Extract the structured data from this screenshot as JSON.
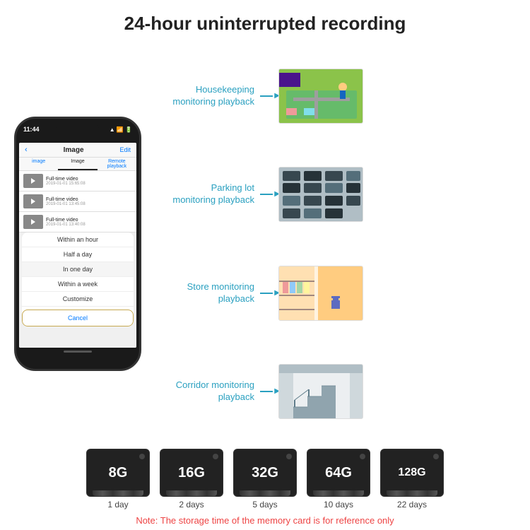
{
  "title": "24-hour uninterrupted recording",
  "phone": {
    "time": "11:44",
    "icons": "📶 🔋",
    "header": {
      "back": "‹",
      "title": "Image",
      "edit": "Edit"
    },
    "tabs": [
      "image",
      "Image",
      "Remote playback"
    ],
    "list_items": [
      {
        "label": "Full-time video",
        "time": "2019-01-01 15:65:08"
      },
      {
        "label": "Full-time video",
        "time": "2019-01-01 13:45:08"
      },
      {
        "label": "Full-time video",
        "time": "2019-01-01 13:40:08"
      }
    ],
    "dropdown": {
      "items": [
        "Within an hour",
        "Half a day",
        "In one day",
        "Within a week",
        "Customize"
      ],
      "cancel": "Cancel"
    }
  },
  "monitoring": [
    {
      "label": "Housekeeping\nmonitoring playback",
      "img_class": "img-housekeeping"
    },
    {
      "label": "Parking lot\nmonitoring playback",
      "img_class": "img-parking"
    },
    {
      "label": "Store monitoring\nplayback",
      "img_class": "img-store"
    },
    {
      "label": "Corridor monitoring\nplayback",
      "img_class": "img-corridor"
    }
  ],
  "sd_cards": [
    {
      "size": "8G",
      "days": "1 day"
    },
    {
      "size": "16G",
      "days": "2 days"
    },
    {
      "size": "32G",
      "days": "5 days"
    },
    {
      "size": "64G",
      "days": "10 days"
    },
    {
      "size": "128G",
      "days": "22 days"
    }
  ],
  "note": "Note: The storage time of the memory card is for reference only"
}
